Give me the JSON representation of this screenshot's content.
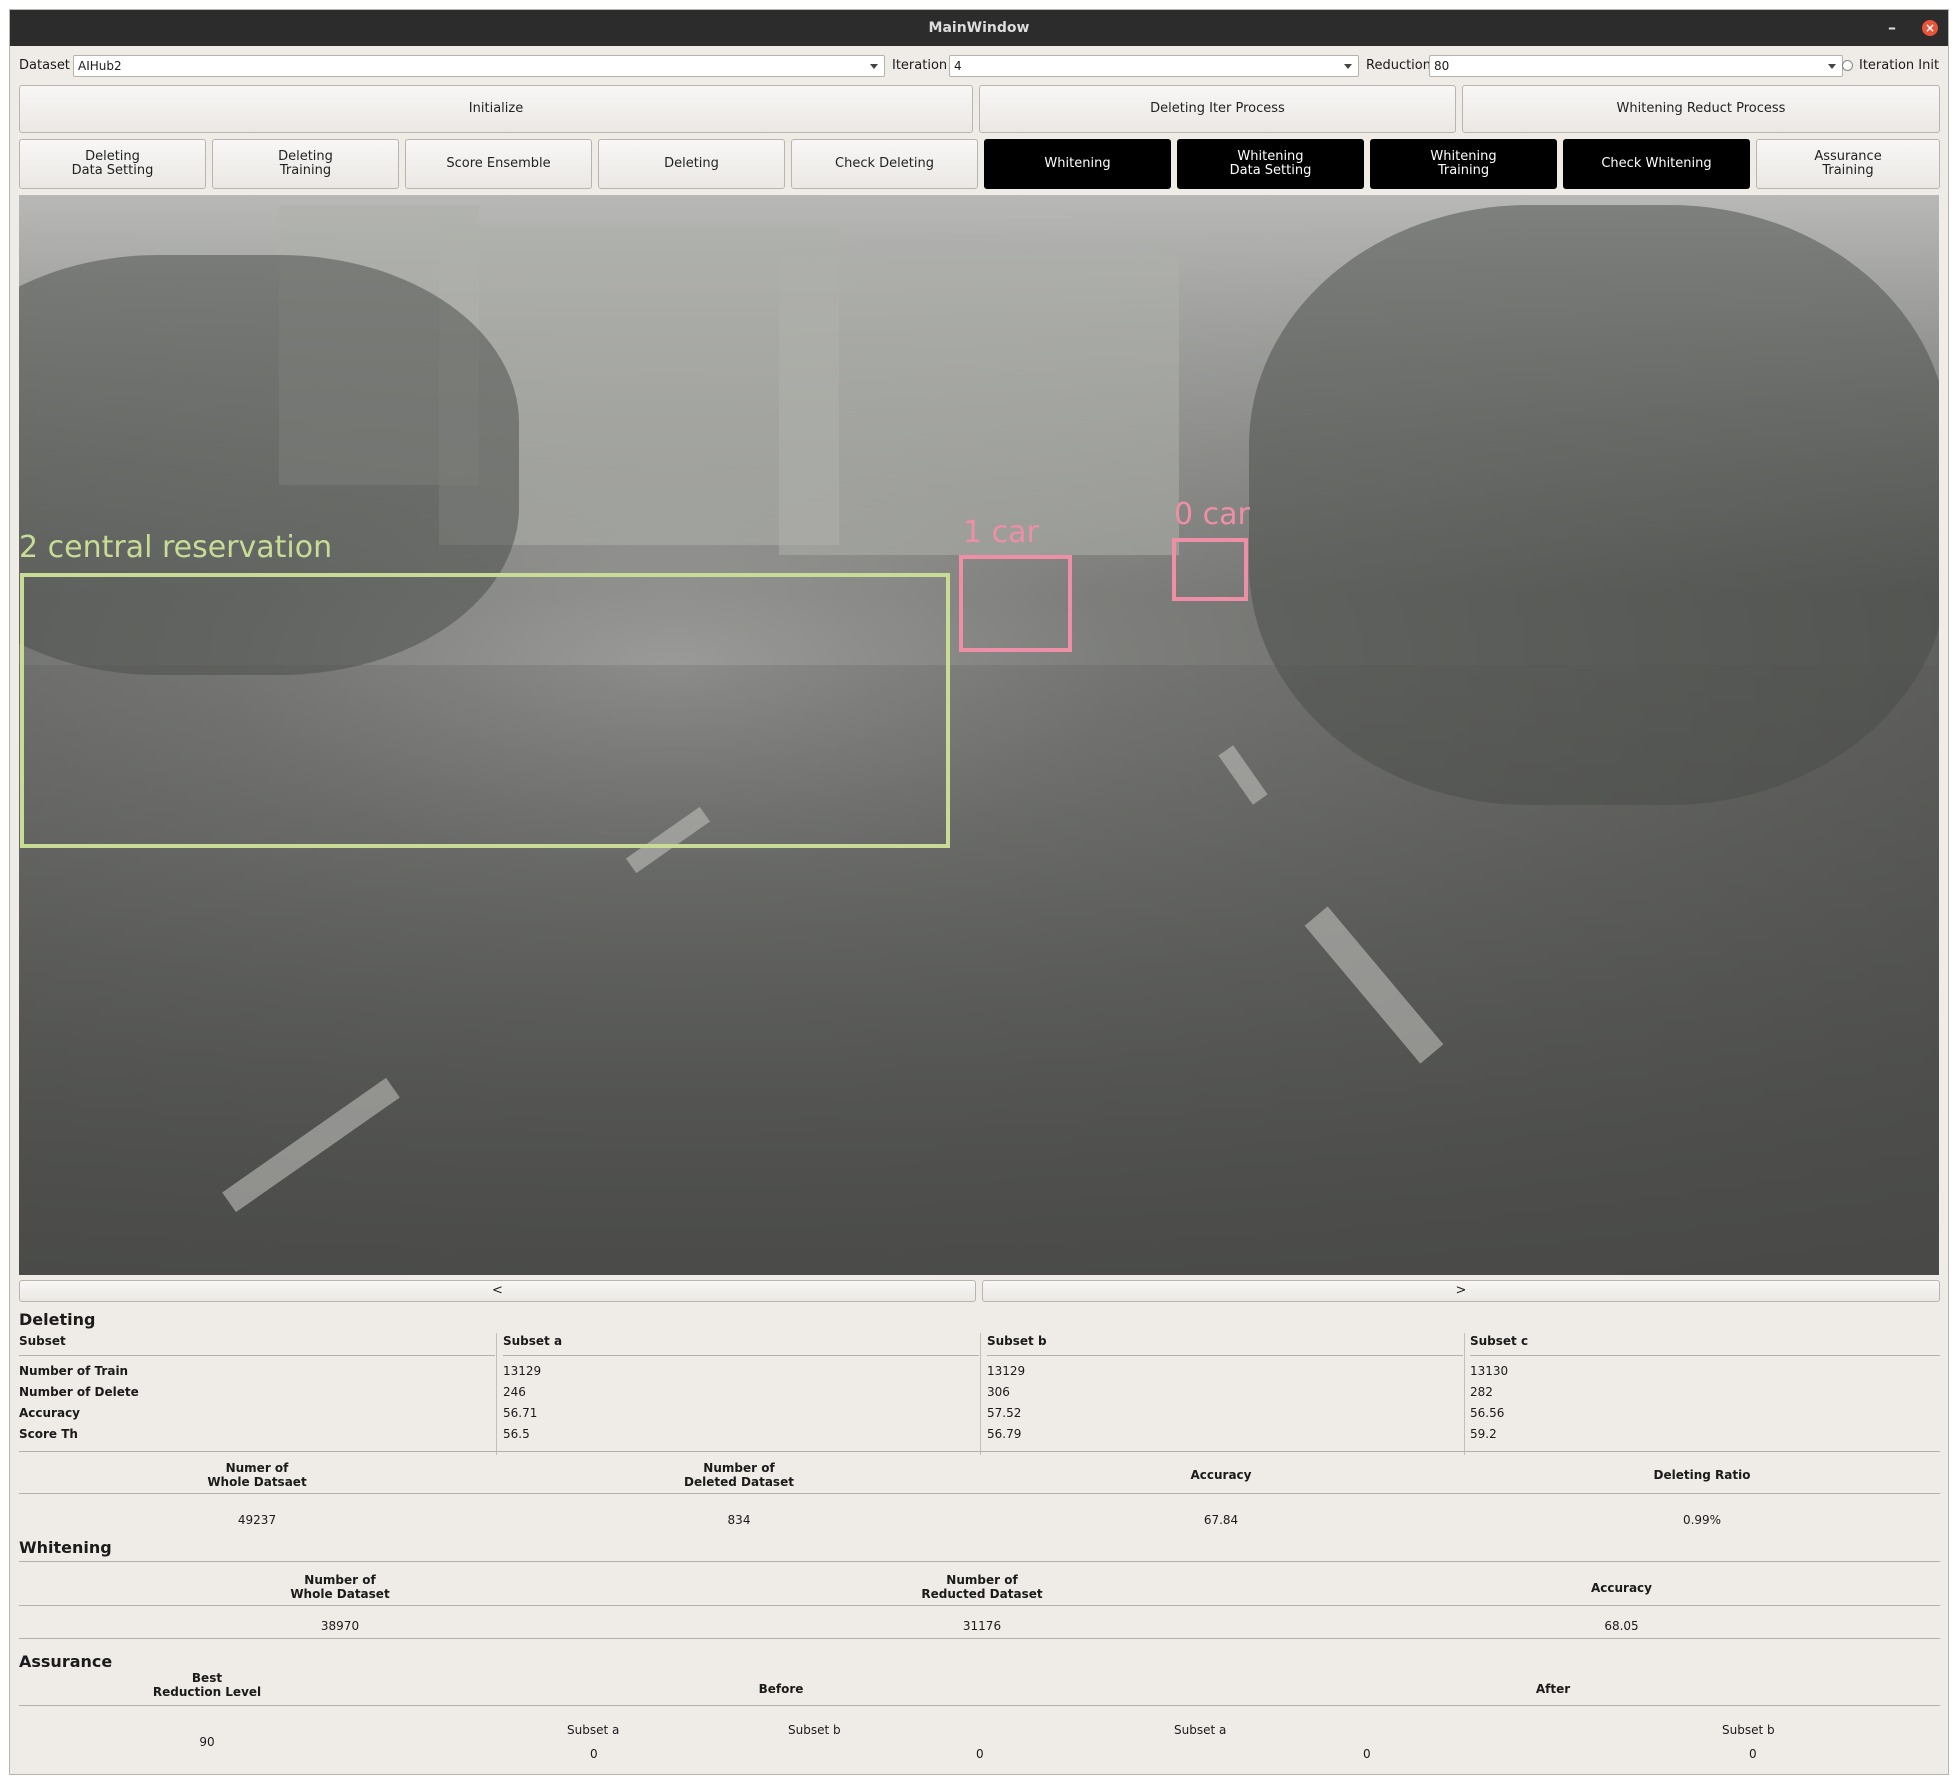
{
  "window": {
    "title": "MainWindow"
  },
  "toolbar": {
    "dataset_label": "Dataset",
    "dataset_value": "AIHub2",
    "iteration_label": "Iteration",
    "iteration_value": "4",
    "reduction_label": "Reduction",
    "reduction_value": "80",
    "iteration_init_label": "Iteration Init"
  },
  "process_buttons": {
    "initialize": "Initialize",
    "deleting_iter": "Deleting Iter Process",
    "whitening_reduct": "Whitening Reduct Process"
  },
  "step_buttons": [
    "Deleting\nData Setting",
    "Deleting\nTraining",
    "Score Ensemble",
    "Deleting",
    "Check Deleting",
    "Whitening",
    "Whitening\nData Setting",
    "Whitening\nTraining",
    "Check Whitening",
    "Assurance\nTraining"
  ],
  "detections": [
    {
      "label": "2  central  reservation",
      "color": "#c8dc96"
    },
    {
      "label": "1  car",
      "color": "#ee8fa6"
    },
    {
      "label": "0  car",
      "color": "#ee8fa6"
    }
  ],
  "nav": {
    "prev": "<",
    "next": ">"
  },
  "deleting": {
    "title": "Deleting",
    "headers": [
      "Subset",
      "Subset a",
      "Subset b",
      "Subset c"
    ],
    "row_labels": [
      "Number of Train",
      "Number of Delete",
      "Accuracy",
      "Score Th"
    ],
    "subset_a": [
      "13129",
      "246",
      "56.71",
      "56.5"
    ],
    "subset_b": [
      "13129",
      "306",
      "57.52",
      "56.79"
    ],
    "subset_c": [
      "13130",
      "282",
      "56.56",
      "59.2"
    ],
    "summary_headers": [
      "Numer of\nWhole Datsaet",
      "Number of\nDeleted Dataset",
      "Accuracy",
      "Deleting Ratio"
    ],
    "summary_values": [
      "49237",
      "834",
      "67.84",
      "0.99%"
    ]
  },
  "whitening": {
    "title": "Whitening",
    "headers": [
      "Number of\nWhole Dataset",
      "Number of\nReducted Dataset",
      "Accuracy"
    ],
    "values": [
      "38970",
      "31176",
      "68.05"
    ]
  },
  "assurance": {
    "title": "Assurance",
    "headers": [
      "Best\nReduction Level",
      "Before",
      "After"
    ],
    "best_level": "90",
    "before_subsets": [
      "Subset a",
      "Subset b"
    ],
    "after_subsets": [
      "Subset a",
      "Subset b"
    ],
    "values": [
      "0",
      "0",
      "0",
      "0"
    ]
  }
}
